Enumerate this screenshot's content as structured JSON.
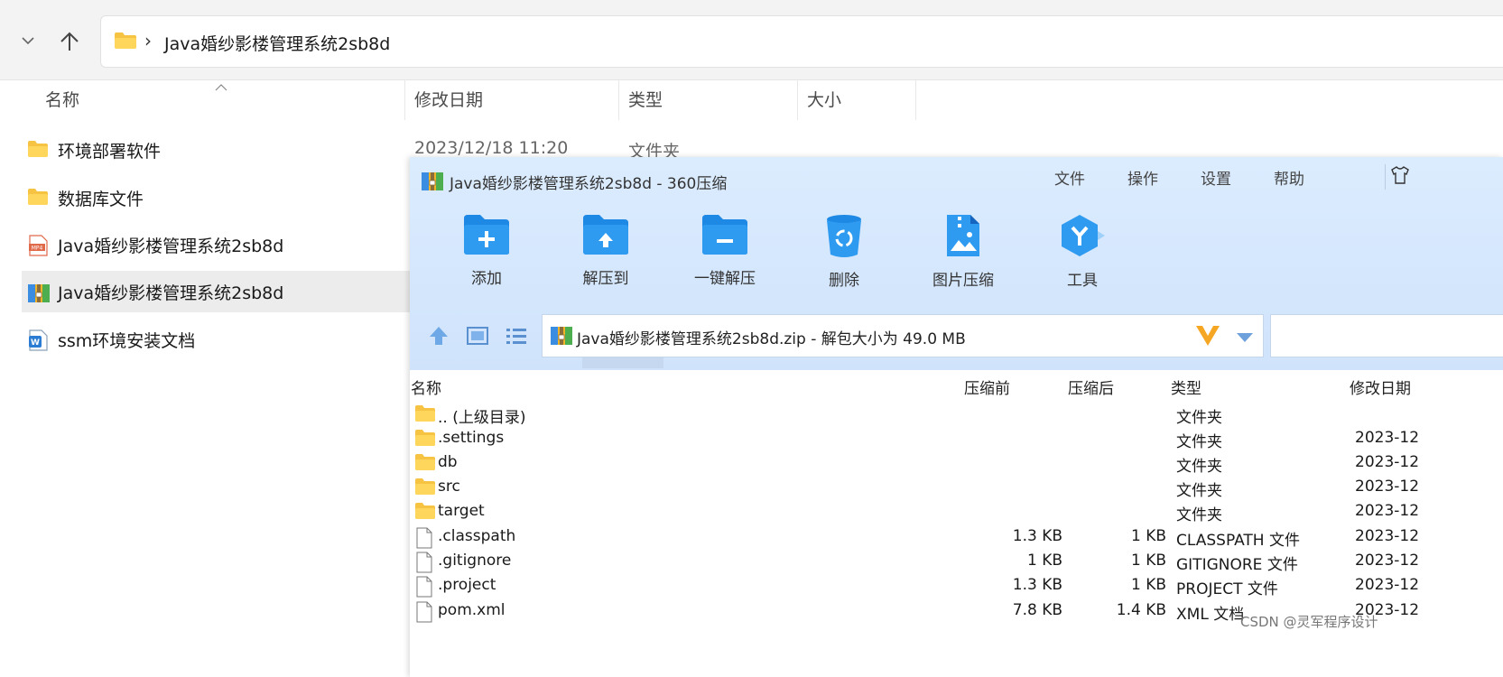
{
  "explorer": {
    "address_path": "Java婚纱影楼管理系统2sb8d",
    "columns": {
      "name": "名称",
      "modified": "修改日期",
      "type": "类型",
      "size": "大小"
    },
    "items": [
      {
        "name": "环境部署软件",
        "icon": "folder-icon",
        "modified": "2023/12/18 11:20",
        "type": "文件夹"
      },
      {
        "name": "数据库文件",
        "icon": "folder-icon"
      },
      {
        "name": "Java婚纱影楼管理系统2sb8d",
        "icon": "mp4-file-icon"
      },
      {
        "name": "Java婚纱影楼管理系统2sb8d",
        "icon": "zip-archive-icon",
        "selected": true
      },
      {
        "name": "ssm环境安装文档",
        "icon": "word-doc-icon"
      }
    ]
  },
  "zip": {
    "title": "Java婚纱影楼管理系统2sb8d - 360压缩",
    "menu": [
      "文件",
      "操作",
      "设置",
      "帮助"
    ],
    "toolbar": [
      "添加",
      "解压到",
      "一键解压",
      "删除",
      "图片压缩",
      "工具"
    ],
    "address": "Java婚纱影楼管理系统2sb8d.zip - 解包大小为 49.0 MB",
    "columns": {
      "name": "名称",
      "before": "压缩前",
      "after": "压缩后",
      "type": "类型",
      "modified": "修改日期"
    },
    "rows": [
      {
        "name": ".. (上级目录)",
        "icon": "folder-icon",
        "before": "",
        "after": "",
        "type": "文件夹",
        "modified": ""
      },
      {
        "name": ".settings",
        "icon": "folder-icon",
        "before": "",
        "after": "",
        "type": "文件夹",
        "modified": "2023-12"
      },
      {
        "name": "db",
        "icon": "folder-icon",
        "before": "",
        "after": "",
        "type": "文件夹",
        "modified": "2023-12"
      },
      {
        "name": "src",
        "icon": "folder-icon",
        "before": "",
        "after": "",
        "type": "文件夹",
        "modified": "2023-12"
      },
      {
        "name": "target",
        "icon": "folder-icon",
        "before": "",
        "after": "",
        "type": "文件夹",
        "modified": "2023-12"
      },
      {
        "name": ".classpath",
        "icon": "file-icon",
        "before": "1.3 KB",
        "after": "1 KB",
        "type": "CLASSPATH 文件",
        "modified": "2023-12"
      },
      {
        "name": ".gitignore",
        "icon": "file-icon",
        "before": "1 KB",
        "after": "1 KB",
        "type": "GITIGNORE 文件",
        "modified": "2023-12"
      },
      {
        "name": ".project",
        "icon": "file-icon",
        "before": "1.3 KB",
        "after": "1 KB",
        "type": "PROJECT 文件",
        "modified": "2023-12"
      },
      {
        "name": "pom.xml",
        "icon": "file-icon",
        "before": "7.8 KB",
        "after": "1.4 KB",
        "type": "XML 文档",
        "modified": "2023-12"
      }
    ]
  },
  "watermark": "CSDN @灵军程序设计",
  "colors": {
    "folder": "#f6c343",
    "accent": "#2a8cf0",
    "selection": "#ececec",
    "zip_header": "#d6e8fd"
  }
}
